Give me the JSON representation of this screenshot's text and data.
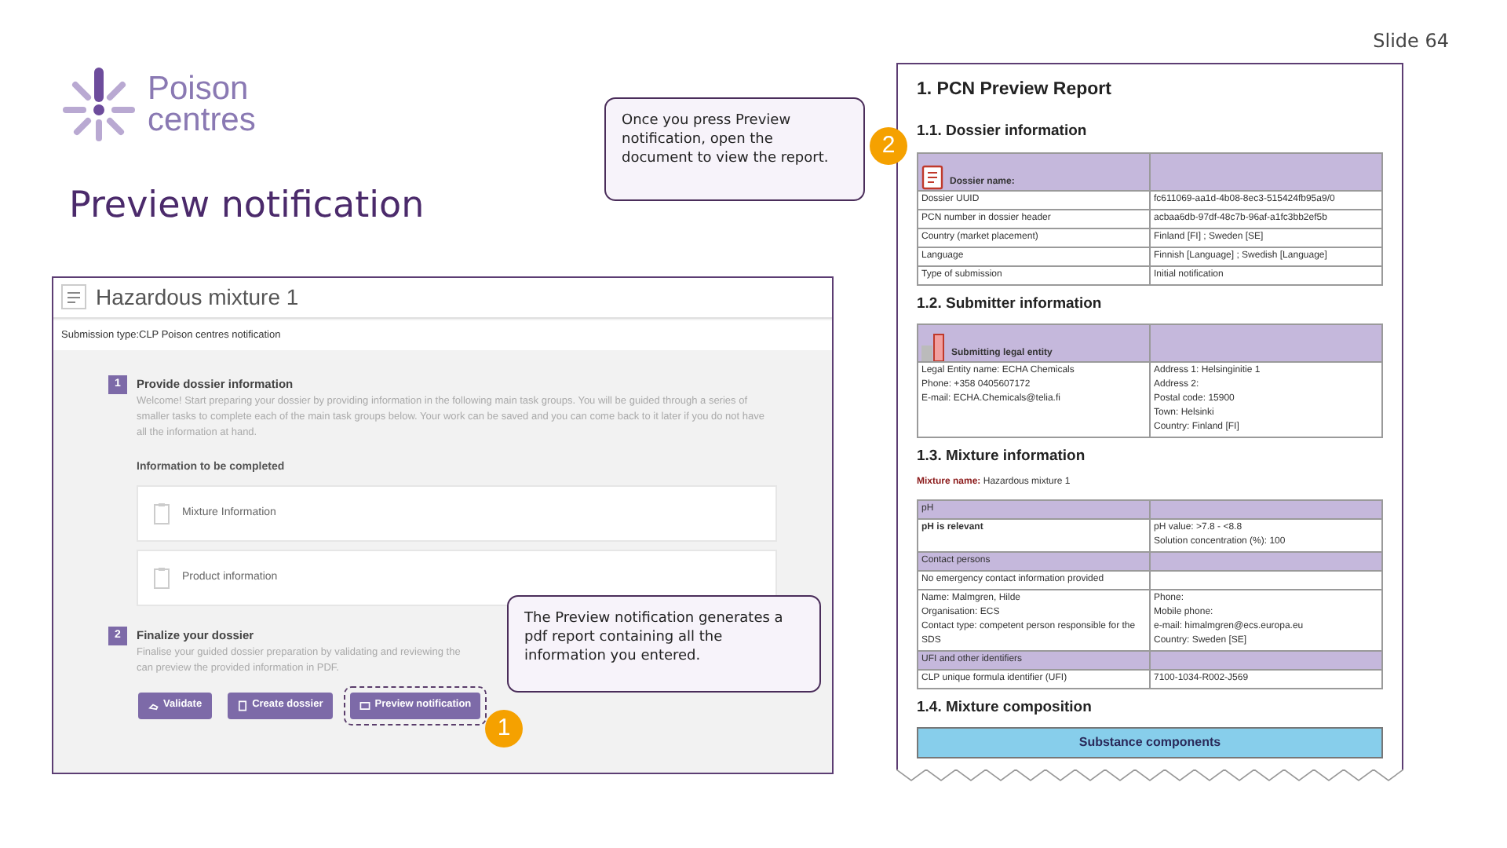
{
  "slide_number": "Slide 64",
  "logo": {
    "line1": "Poison",
    "line2": "centres"
  },
  "title": "Preview notification",
  "app": {
    "title": "Hazardous mixture 1",
    "submission_type": "Submission type:CLP Poison centres notification",
    "steps": [
      {
        "number": "1",
        "title": "Provide dossier information",
        "description": [
          "Welcome! Start preparing your dossier by providing information in the following main task groups. You will be guided through a series of smaller tasks to complete each of the main task groups below. Your work can be saved and you can come back to it later if you do not have all the information at hand."
        ]
      },
      {
        "number": "2",
        "title": "Finalize your dossier",
        "description": [
          "Finalise your guided dossier preparation by validating and reviewing the",
          "can preview the provided information in PDF."
        ]
      }
    ],
    "section_label": "Information to be completed",
    "tasks": [
      "Mixture Information",
      "Product information"
    ],
    "buttons": [
      {
        "label": "Validate",
        "kind": "validate",
        "highlighted": false
      },
      {
        "label": "Create dossier",
        "kind": "dossier",
        "highlighted": false
      },
      {
        "label": "Preview notification",
        "kind": "preview",
        "highlighted": true
      }
    ]
  },
  "callouts": [
    {
      "number": "2",
      "text": "Once you press Preview notification, open the document to view the report."
    },
    {
      "number": "1",
      "text": "The Preview notification generates a pdf report containing all the information you entered."
    }
  ],
  "report": {
    "title": "1. PCN Preview Report",
    "dossier": {
      "heading": "1.1. Dossier information",
      "header": "Dossier name:",
      "rows": [
        [
          "Dossier UUID",
          "fc611069-aa1d-4b08-8ec3-515424fb95a9/0"
        ],
        [
          "PCN number in dossier header",
          "acbaa6db-97df-48c7b-96af-a1fc3bb2ef5b"
        ],
        [
          "Country (market placement)",
          "Finland [FI] ; Sweden [SE]"
        ],
        [
          "Language",
          "Finnish [Language] ; Swedish [Language]"
        ],
        [
          "Type of submission",
          "Initial notification"
        ]
      ]
    },
    "submitter": {
      "heading": "1.2. Submitter information",
      "header": "Submitting legal entity",
      "left": [
        "Legal Entity name: ECHA Chemicals",
        "Phone: +358 0405607172",
        "E-mail: ECHA.Chemicals@telia.fi"
      ],
      "right": [
        "Address 1: Helsinginitie 1",
        "Address 2:",
        "Postal code: 15900",
        "Town: Helsinki",
        "Country: Finland [FI]"
      ]
    },
    "mixture": {
      "heading": "1.3. Mixture information",
      "name_label": "Mixture name:",
      "name": "Hazardous mixture 1",
      "rows": [
        {
          "kind": "header",
          "left": [
            "pH"
          ],
          "right": []
        },
        {
          "kind": "bold",
          "left": [
            "pH is relevant"
          ],
          "right": [
            "pH value: >7.8 - <8.8",
            "Solution concentration (%): 100"
          ]
        },
        {
          "kind": "header",
          "left": [
            "Contact persons"
          ],
          "right": []
        },
        {
          "kind": "plain",
          "left": [
            "No emergency contact information provided"
          ],
          "right": []
        },
        {
          "kind": "plain",
          "left": [
            "Name: Malmgren, Hilde",
            "Organisation: ECS",
            "Contact type: competent person responsible for the SDS"
          ],
          "right": [
            "Phone:",
            "Mobile phone:",
            "e-mail: himalmgren@ecs.europa.eu",
            "Country: Sweden [SE]"
          ]
        },
        {
          "kind": "header",
          "left": [
            "UFI and other identifiers"
          ],
          "right": []
        },
        {
          "kind": "plain",
          "left": [
            "CLP unique formula identifier (UFI)"
          ],
          "right": [
            "7100-1034-R002-J569"
          ]
        }
      ]
    },
    "composition": {
      "heading": "1.4. Mixture composition",
      "band": "Substance components"
    }
  }
}
